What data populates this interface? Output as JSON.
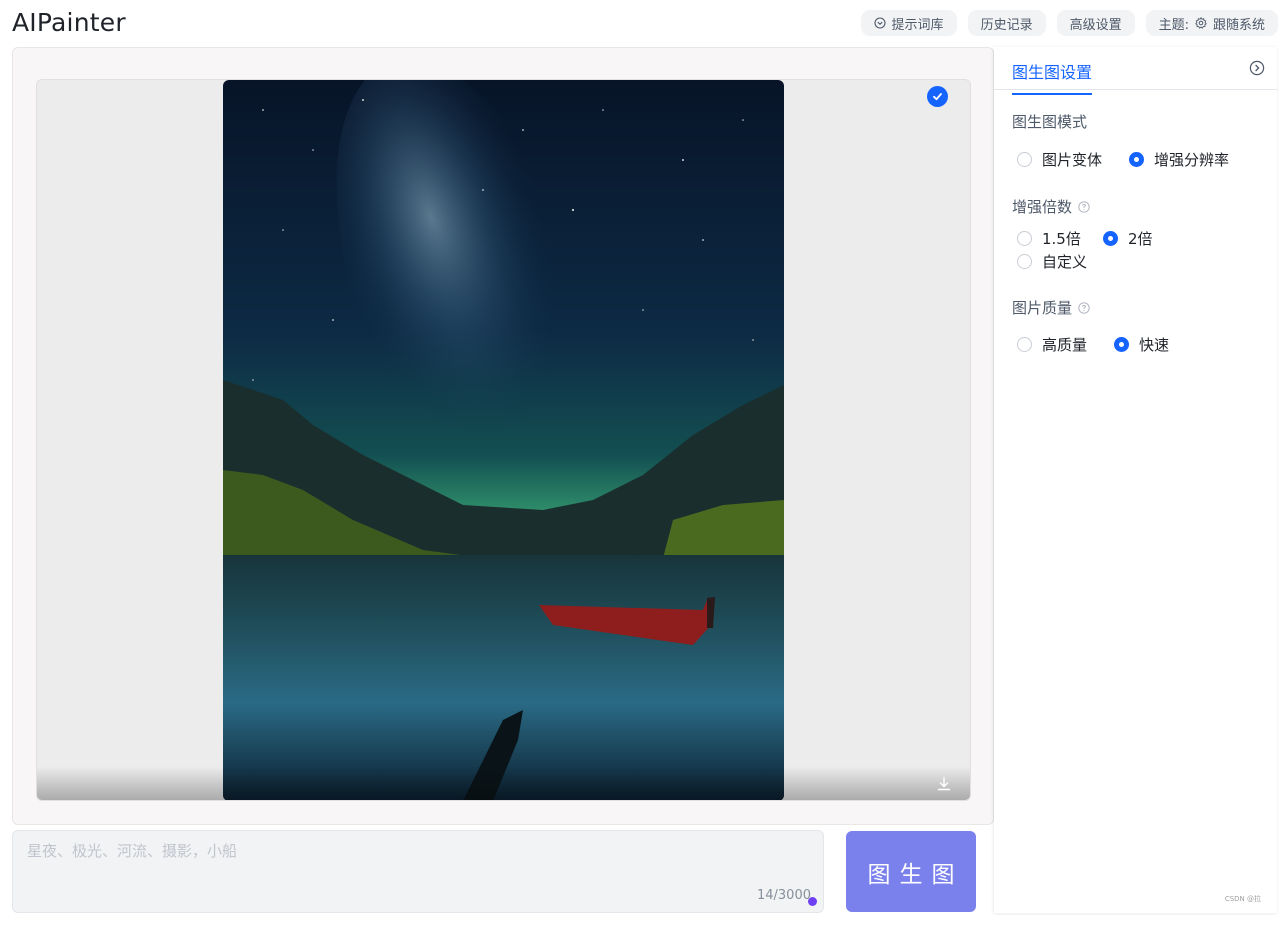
{
  "app": {
    "title": "AIPainter"
  },
  "top_actions": {
    "prompt_library": "提示词库",
    "history": "历史记录",
    "advanced_settings": "高级设置",
    "theme_label": "主题:",
    "theme_value": "跟随系统"
  },
  "canvas": {
    "image_icon": "starry-lake-photo",
    "selected": true
  },
  "prompt": {
    "placeholder": "星夜、极光、河流、摄影，小船",
    "char_count": "14/3000"
  },
  "generate_label": "图生图",
  "panel": {
    "tab_label": "图生图设置",
    "sections": {
      "mode": {
        "title": "图生图模式",
        "options": [
          "图片变体",
          "增强分辨率"
        ],
        "selected": "增强分辨率"
      },
      "scale": {
        "title": "增强倍数",
        "options": [
          "1.5倍",
          "2倍",
          "自定义"
        ],
        "selected": "2倍"
      },
      "quality": {
        "title": "图片质量",
        "options": [
          "高质量",
          "快速"
        ],
        "selected": "快速"
      }
    }
  },
  "watermark": "CSDN @拉",
  "colors": {
    "accent": "#1664ff",
    "generate_button": "#7a80ec"
  }
}
